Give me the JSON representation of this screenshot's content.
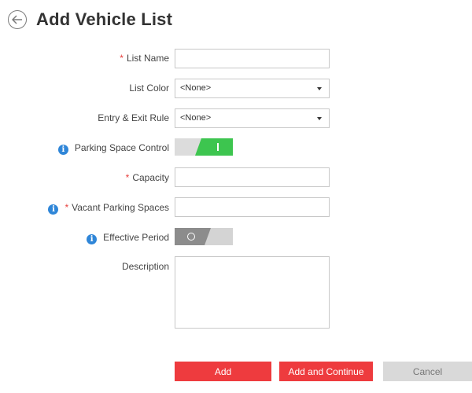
{
  "header": {
    "title": "Add Vehicle List"
  },
  "form": {
    "list_name": {
      "label": "List Name",
      "required": "*",
      "value": ""
    },
    "list_color": {
      "label": "List Color",
      "value": "<None>"
    },
    "entry_exit_rule": {
      "label": "Entry & Exit Rule",
      "value": "<None>"
    },
    "parking_space_control": {
      "label": "Parking Space Control",
      "info": "i",
      "state": "on"
    },
    "capacity": {
      "label": "Capacity",
      "required": "*",
      "value": ""
    },
    "vacant_parking_spaces": {
      "label": "Vacant Parking Spaces",
      "info": "i",
      "required": "*",
      "value": ""
    },
    "effective_period": {
      "label": "Effective Period",
      "info": "i",
      "state": "off"
    },
    "description": {
      "label": "Description",
      "value": ""
    }
  },
  "buttons": {
    "add": "Add",
    "add_continue": "Add and Continue",
    "cancel": "Cancel"
  },
  "colors": {
    "primary": "#ee3b3e",
    "toggle_on": "#3dc54f",
    "info": "#2f86d8",
    "required": "#e8403d"
  }
}
